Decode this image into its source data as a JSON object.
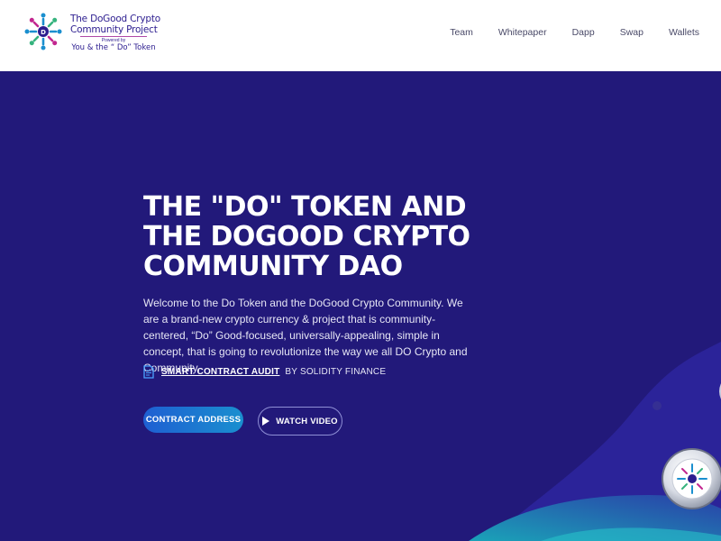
{
  "header": {
    "brand": {
      "line1": "The DoGood Crypto",
      "line2": "Community Project",
      "powered": "Powered by",
      "line3": "You & the “ Do” Token"
    },
    "nav": [
      {
        "label": "Team"
      },
      {
        "label": "Whitepaper"
      },
      {
        "label": "Dapp"
      },
      {
        "label": "Swap"
      },
      {
        "label": "Wallets"
      }
    ]
  },
  "hero": {
    "title_lines": [
      "THE \"DO\" TOKEN AND",
      "THE DOGOOD CRYPTO",
      "COMMUNITY DAO"
    ],
    "description": "Welcome to the Do Token and the DoGood Crypto Community. We are a brand-new crypto currency & project that is community-centered, “Do” Good-focused, universally-appealing, simple in concept, that is going to revolutionize the way we all DO Crypto and Community.",
    "audit_link": "SMART CONTRACT AUDIT",
    "audit_by": "BY SOLIDITY FINANCE",
    "contract_button": "CONTRACT ADDRESS",
    "video_button": "WATCH VIDEO"
  },
  "colors": {
    "hero_bg": "#22197a",
    "header_bg": "#ffffff",
    "brand_text": "#2c1d8f",
    "button_gradient_start": "#1e5fd2",
    "button_gradient_end": "#1a8fcf",
    "wave_teal": "#1e95b8"
  },
  "icons": {
    "logo": "dogood-logo",
    "audit": "document-icon",
    "play": "play-icon",
    "coin": "do-token-coin"
  }
}
